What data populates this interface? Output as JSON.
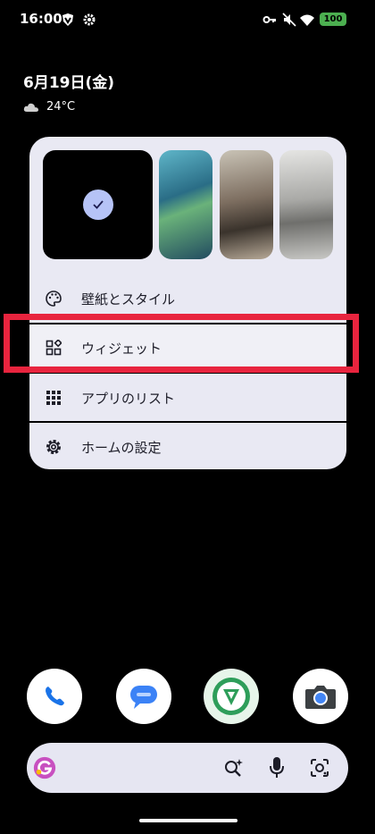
{
  "status_bar": {
    "time": "16:00",
    "battery": "100",
    "icons": [
      "vpn-shield-icon",
      "gear-icon",
      "key-icon",
      "mute-icon",
      "wifi-icon",
      "battery-icon"
    ]
  },
  "home": {
    "date": "6月19日(金)",
    "temperature": "24°C",
    "weather_icon": "cloud-icon"
  },
  "menu": {
    "wallpaper_style": "壁紙とスタイル",
    "widgets": "ウィジェット",
    "app_list": "アプリのリスト",
    "home_settings": "ホームの設定",
    "wallpapers": [
      "current-black",
      "blue-feathers",
      "brown-feathers",
      "grey-feathers"
    ]
  },
  "dock": {
    "apps": [
      "phone-app-icon",
      "messages-app-icon",
      "vpn-app-icon",
      "camera-app-icon"
    ]
  },
  "search": {
    "placeholder": ""
  },
  "colors": {
    "background": "#000000",
    "menu_card": "#e9e9f3",
    "highlight": "#e8243e",
    "battery": "#4caf50",
    "accent_blue": "#1a73e8"
  }
}
